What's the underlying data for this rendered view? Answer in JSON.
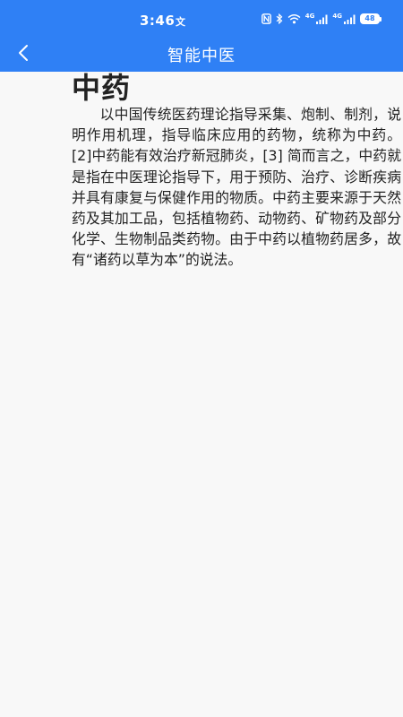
{
  "status_bar": {
    "time": "3:46",
    "time_suffix": "文",
    "battery": "48",
    "network_1": "4G",
    "network_2": "4G"
  },
  "nav": {
    "title": "智能中医",
    "back_icon": "chevron-left-icon"
  },
  "article": {
    "heading": "中药",
    "body": "以中国传统医药理论指导采集、炮制、制剂，说明作用机理，指导临床应用的药物，统称为中药。[2]中药能有效治疗新冠肺炎，[3] 简而言之，中药就是指在中医理论指导下，用于预防、治疗、诊断疾病并具有康复与保健作用的物质。中药主要来源于天然药及其加工品，包括植物药、动物药、矿物药及部分化学、生物制品类药物。由于中药以植物药居多，故有“诸药以草为本”的说法。"
  },
  "colors": {
    "primary": "#2f80f5",
    "background": "#f8f8f8",
    "text": "#222222"
  }
}
